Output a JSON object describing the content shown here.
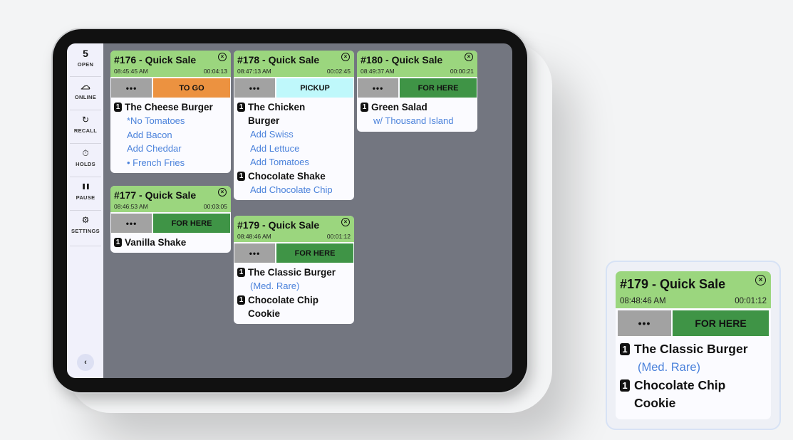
{
  "sidebar": {
    "open_count": "5",
    "items": [
      {
        "label": "OPEN",
        "icon": "count"
      },
      {
        "label": "ONLINE",
        "icon": "cloud-icon",
        "glyph": "☁"
      },
      {
        "label": "RECALL",
        "icon": "recall-icon",
        "glyph": "↻"
      },
      {
        "label": "HOLDS",
        "icon": "stopwatch-icon",
        "glyph": "⏱"
      },
      {
        "label": "PAUSE",
        "icon": "pause-icon",
        "glyph": "❚❚"
      },
      {
        "label": "SETTINGS",
        "icon": "gear-icon",
        "glyph": "⚙"
      }
    ],
    "collapse_glyph": "‹"
  },
  "colors": {
    "header_green": "#9bd67e",
    "to_go": "#ec9240",
    "pickup": "#bff8fb",
    "for_here": "#3f9446",
    "more_gray": "#a2a2a2",
    "modifier_blue": "#4b82db"
  },
  "tickets": [
    {
      "title": "#176 - Quick Sale",
      "time": "08:45:45 AM",
      "elapsed": "00:04:13",
      "more": "•••",
      "type": "TO GO",
      "items": [
        {
          "qty": "1",
          "name": "The Cheese Burger",
          "mods": [
            "*No  Tomatoes",
            "Add Bacon",
            "Add Cheddar",
            "• French Fries"
          ]
        }
      ]
    },
    {
      "title": "#177 - Quick Sale",
      "time": "08:46:53 AM",
      "elapsed": "00:03:05",
      "more": "•••",
      "type": "FOR HERE",
      "items": [
        {
          "qty": "1",
          "name": "Vanilla Shake",
          "mods": []
        }
      ]
    },
    {
      "title": "#178 - Quick Sale",
      "time": "08:47:13 AM",
      "elapsed": "00:02:45",
      "more": "•••",
      "type": "PICKUP",
      "items": [
        {
          "qty": "1",
          "name": "The Chicken Burger",
          "mods": [
            "Add Swiss",
            "Add Lettuce",
            "Add Tomatoes"
          ]
        },
        {
          "qty": "1",
          "name": "Chocolate Shake",
          "mods": [
            "Add Chocolate Chip"
          ]
        }
      ]
    },
    {
      "title": "#179 - Quick Sale",
      "time": "08:48:46 AM",
      "elapsed": "00:01:12",
      "more": "•••",
      "type": "FOR HERE",
      "items": [
        {
          "qty": "1",
          "name": "The Classic Burger",
          "mods": [
            "(Med. Rare)"
          ]
        },
        {
          "qty": "1",
          "name": "Chocolate Chip Cookie",
          "mods": []
        }
      ]
    },
    {
      "title": "#180 - Quick Sale",
      "time": "08:49:37 AM",
      "elapsed": "00:00:21",
      "more": "•••",
      "type": "FOR HERE",
      "items": [
        {
          "qty": "1",
          "name": "Green Salad",
          "mods": [
            "w/ Thousand Island"
          ]
        }
      ]
    }
  ],
  "close_glyph": "×"
}
